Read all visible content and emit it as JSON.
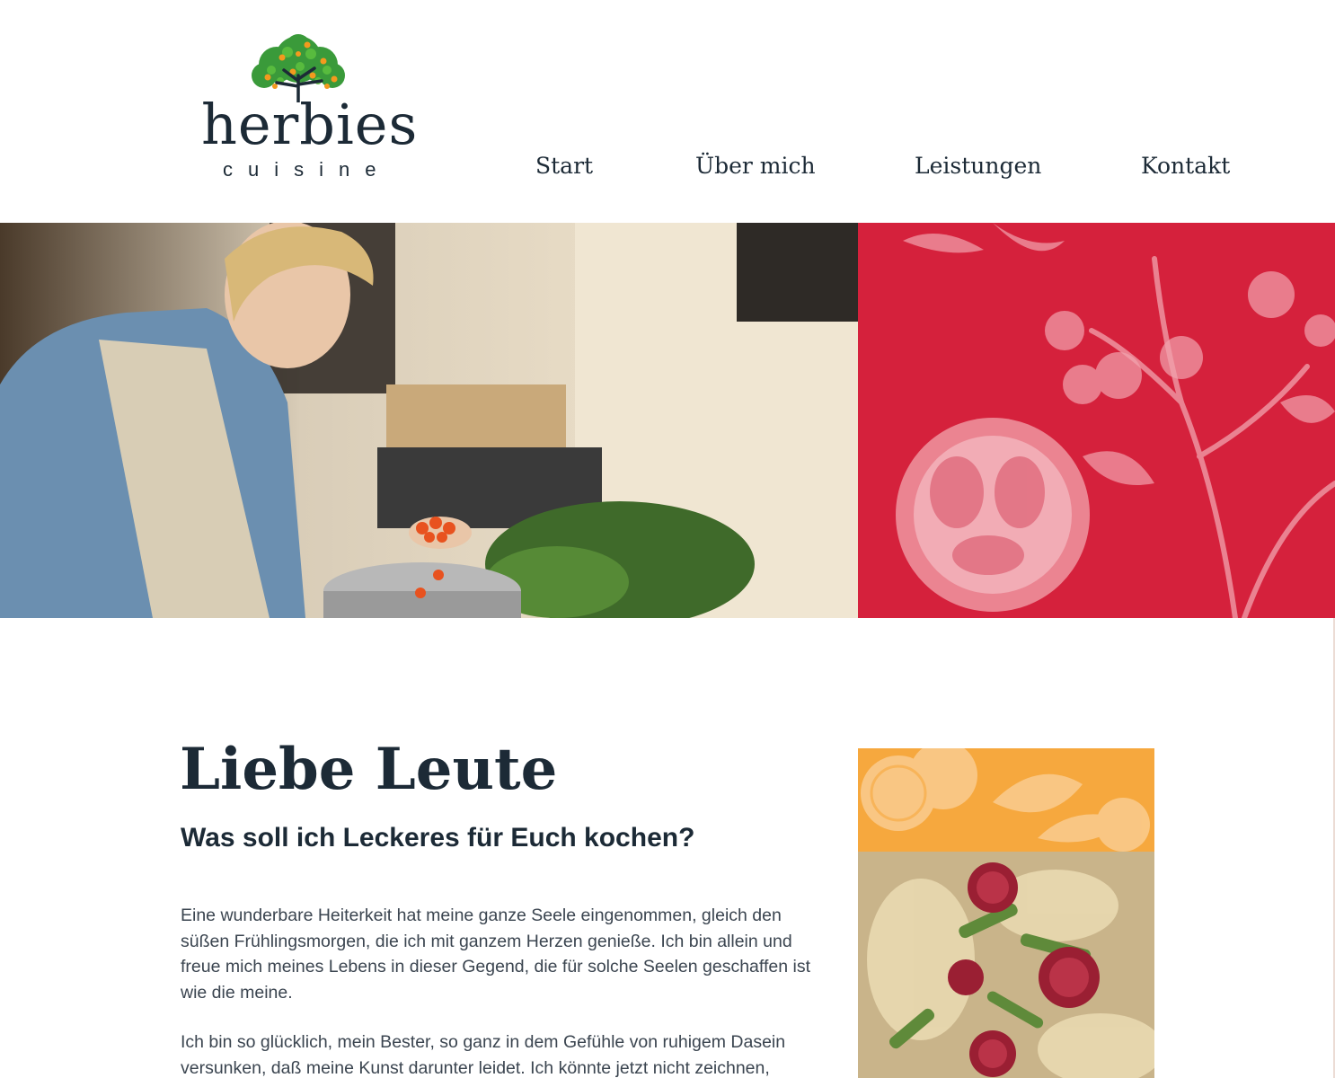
{
  "brand": {
    "name": "herbies",
    "tagline": "cuisine"
  },
  "nav": {
    "items": [
      {
        "label": "Start"
      },
      {
        "label": "Über mich"
      },
      {
        "label": "Leistungen"
      },
      {
        "label": "Kontakt"
      }
    ]
  },
  "colors": {
    "accent_red": "#d5213c",
    "accent_orange": "#f6a83e",
    "text_dark": "#1c2a36"
  },
  "content": {
    "title": "Liebe Leute",
    "subtitle": "Was soll ich Leckeres für Euch kochen?",
    "paragraphs": [
      "Eine wunderbare Heiterkeit hat meine ganze Seele eingenommen, gleich den süßen Frühlingsmorgen, die ich mit ganzem Herzen genieße. Ich bin allein und freue mich meines Lebens in dieser Gegend, die für solche Seelen geschaffen ist wie die meine.",
      "Ich bin so glücklich, mein Bester, so ganz in dem Gefühle von ruhigem Dasein versunken, daß meine Kunst darunter leidet. Ich könnte jetzt nicht zeichnen,"
    ]
  }
}
